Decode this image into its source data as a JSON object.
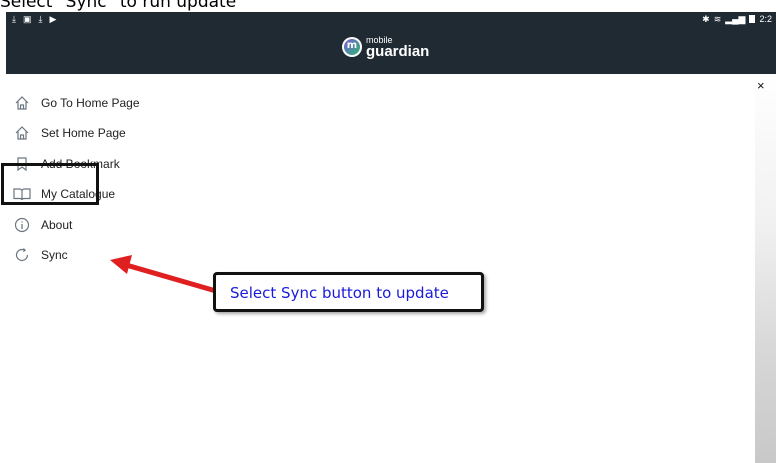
{
  "caption": "Select \"Sync\" to run update",
  "statusbar": {
    "time": "2:2"
  },
  "brand": {
    "top": "mobile",
    "bottom": "guardian",
    "mark": "m"
  },
  "menu": {
    "items": [
      {
        "label": "Go To Home Page",
        "icon": "home-icon"
      },
      {
        "label": "Set Home Page",
        "icon": "home-icon"
      },
      {
        "label": "Add Bookmark",
        "icon": "bookmark-icon"
      },
      {
        "label": "My Catalogue",
        "icon": "book-icon"
      },
      {
        "label": "About",
        "icon": "info-icon"
      },
      {
        "label": "Sync",
        "icon": "sync-icon"
      }
    ]
  },
  "close_label": "×",
  "annotation": {
    "text": "Select Sync button to update"
  },
  "colors": {
    "appbar": "#1f2a33",
    "annotation_text": "#1a1adb",
    "arrow": "#e02020"
  }
}
